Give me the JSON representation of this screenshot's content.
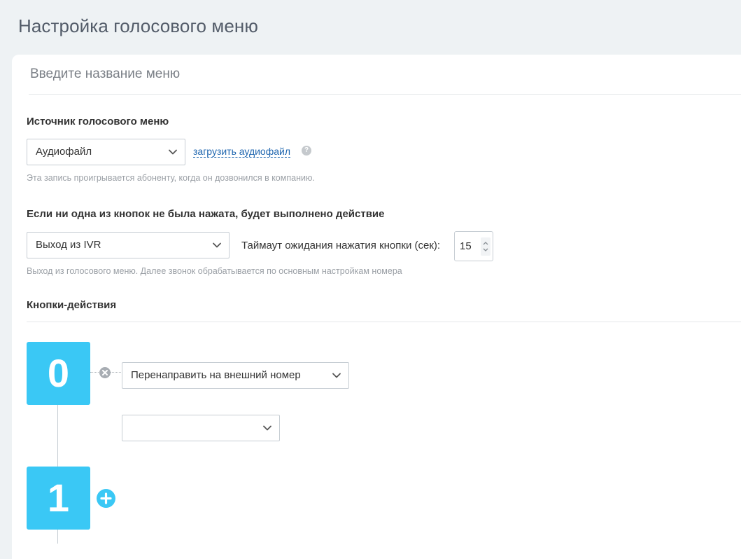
{
  "page": {
    "title": "Настройка голосового меню"
  },
  "menu_name": {
    "placeholder": "Введите название меню"
  },
  "source": {
    "label": "Источник голосового меню",
    "selected": "Аудиофайл",
    "upload_link": "загрузить аудиофайл",
    "help_icon": "?",
    "hint": "Эта запись проигрывается абоненту, когда он дозвонился в компанию."
  },
  "default_action": {
    "label": "Если ни одна из кнопок не была нажата, будет выполнено действие",
    "selected": "Выход из IVR",
    "timeout_label": "Таймаут ожидания нажатия кнопки (сек):",
    "timeout_value": "15",
    "hint": "Выход из голосового меню. Далее звонок обрабатывается по основным настройкам номера"
  },
  "buttons": {
    "label": "Кнопки-действия",
    "items": [
      {
        "digit": "0",
        "action": "Перенаправить на внешний номер",
        "target": ""
      },
      {
        "digit": "1"
      }
    ]
  },
  "colors": {
    "accent": "#3ac8f5",
    "link": "#2067b0",
    "background": "#eef2f4"
  },
  "icons": {
    "chevron": "chevron-down-icon",
    "remove": "close-circle-icon",
    "add": "plus-circle-icon",
    "help": "question-circle-icon"
  }
}
